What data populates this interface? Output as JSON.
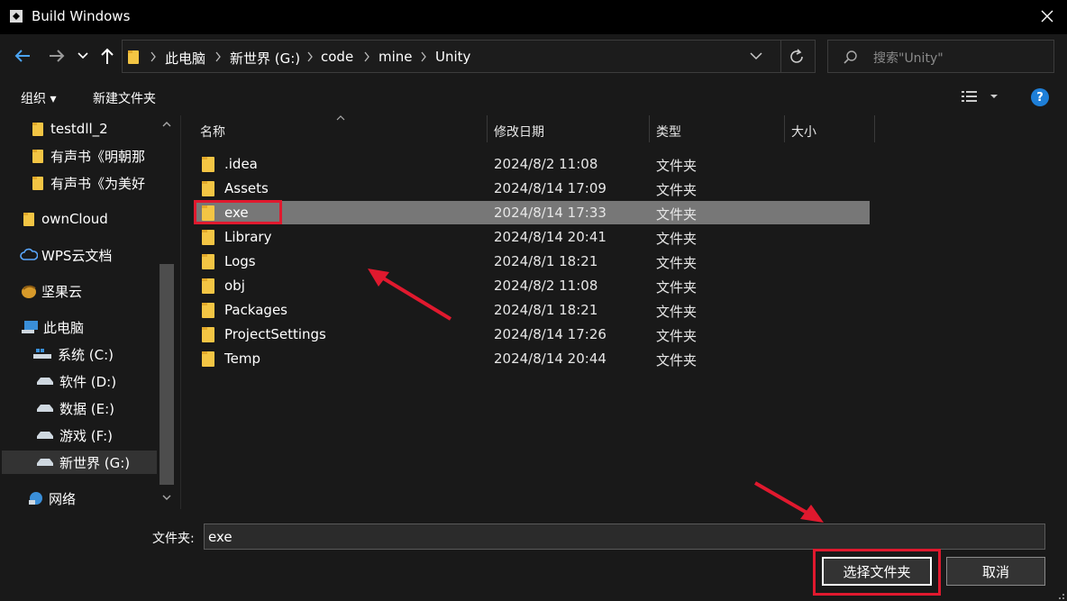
{
  "window": {
    "title": "Build Windows"
  },
  "address": {
    "crumbs": [
      "此电脑",
      "新世界 (G:)",
      "code",
      "mine",
      "Unity"
    ]
  },
  "search": {
    "placeholder": "搜索\"Unity\""
  },
  "commands": {
    "organize": "组织 ▾",
    "new_folder": "新建文件夹"
  },
  "sidebar": {
    "items": [
      {
        "label": "testdll_2",
        "icon": "folder-icon"
      },
      {
        "label": "有声书《明朝那",
        "icon": "folder-icon"
      },
      {
        "label": "有声书《为美好",
        "icon": "folder-icon"
      },
      {
        "label": "ownCloud",
        "icon": "folder-icon"
      },
      {
        "label": "WPS云文档",
        "icon": "cloud-icon"
      },
      {
        "label": "坚果云",
        "icon": "nut-icon"
      },
      {
        "label": "此电脑",
        "icon": "computer-icon"
      },
      {
        "label": "系统 (C:)",
        "icon": "system-drive-icon"
      },
      {
        "label": "软件 (D:)",
        "icon": "drive-icon"
      },
      {
        "label": "数据 (E:)",
        "icon": "drive-icon"
      },
      {
        "label": "游戏 (F:)",
        "icon": "drive-icon"
      },
      {
        "label": "新世界 (G:)",
        "icon": "drive-icon",
        "selected": true
      },
      {
        "label": "网络",
        "icon": "network-icon"
      }
    ]
  },
  "columns": {
    "name": "名称",
    "modified": "修改日期",
    "type": "类型",
    "size": "大小"
  },
  "files": [
    {
      "name": ".idea",
      "modified": "2024/8/2 11:08",
      "type": "文件夹"
    },
    {
      "name": "Assets",
      "modified": "2024/8/14 17:09",
      "type": "文件夹"
    },
    {
      "name": "exe",
      "modified": "2024/8/14 17:33",
      "type": "文件夹",
      "selected": true
    },
    {
      "name": "Library",
      "modified": "2024/8/14 20:41",
      "type": "文件夹"
    },
    {
      "name": "Logs",
      "modified": "2024/8/1 18:21",
      "type": "文件夹"
    },
    {
      "name": "obj",
      "modified": "2024/8/2 11:08",
      "type": "文件夹"
    },
    {
      "name": "Packages",
      "modified": "2024/8/1 18:21",
      "type": "文件夹"
    },
    {
      "name": "ProjectSettings",
      "modified": "2024/8/14 17:26",
      "type": "文件夹"
    },
    {
      "name": "Temp",
      "modified": "2024/8/14 20:44",
      "type": "文件夹"
    }
  ],
  "footer": {
    "folder_label": "文件夹:",
    "folder_value": "exe",
    "select_button": "选择文件夹",
    "cancel_button": "取消"
  },
  "colors": {
    "annotation": "#e0192e",
    "selection": "#777777",
    "folder": "#f3c544",
    "help": "#1e7fd8"
  }
}
